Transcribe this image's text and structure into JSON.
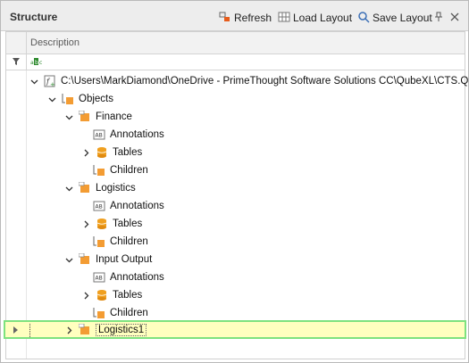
{
  "panel": {
    "title": "Structure",
    "toolbar": {
      "refresh_label": "Refresh",
      "load_label": "Load Layout",
      "save_label": "Save Layout"
    }
  },
  "grid": {
    "column_header": "Description",
    "filter_icon": "funnel-icon",
    "filter_type_glyph": "abc-icon"
  },
  "tree": {
    "root_path": "C:\\Users\\MarkDiamond\\OneDrive - PrimeThought Software Solutions CC\\QubeXL\\CTS.Qub...",
    "objects": "Objects",
    "finance": "Finance",
    "logistics": "Logistics",
    "input_output": "Input Output",
    "annotations": "Annotations",
    "tables": "Tables",
    "children": "Children",
    "logistics1": "Logistics1"
  },
  "colors": {
    "selected_bg": "#ffffbf",
    "selected_border": "#7ee27e",
    "folder_orange": "#f39c33",
    "db_orange": "#f0a020"
  }
}
